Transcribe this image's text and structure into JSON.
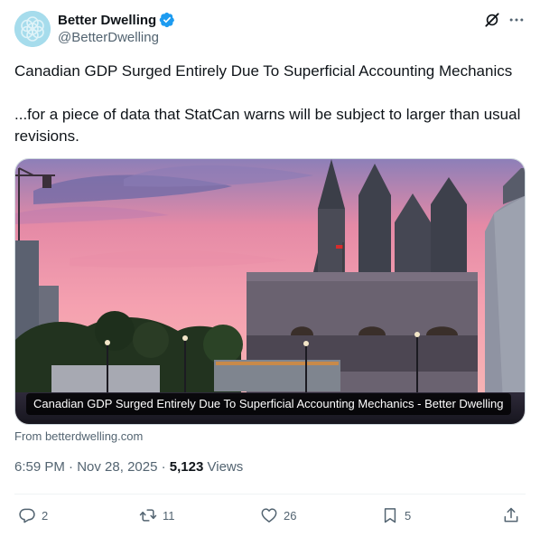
{
  "author": {
    "display_name": "Better Dwelling",
    "handle": "@BetterDwelling",
    "verified": true
  },
  "tweet": {
    "text_line1": "Canadian GDP Surged Entirely Due To Superficial Accounting Mechanics",
    "text_line2": "...for a piece of data that StatCan warns will be subject to larger than usual revisions."
  },
  "card": {
    "caption": "Canadian GDP Surged Entirely Due To Superficial Accounting Mechanics - Better Dwelling",
    "source": "From betterdwelling.com"
  },
  "meta": {
    "time": "6:59 PM",
    "sep1": " · ",
    "date": "Nov 28, 2025",
    "sep2": " · ",
    "views_count": "5,123",
    "views_label": " Views"
  },
  "actions": {
    "replies": "2",
    "reposts": "11",
    "likes": "26",
    "bookmarks": "5"
  },
  "colors": {
    "text_primary": "#0f1419",
    "text_secondary": "#536471",
    "verified_blue": "#1d9bf0",
    "divider": "#eff3f4"
  },
  "icons": [
    "avatar-logo",
    "verified-icon",
    "grok-icon",
    "more-icon",
    "reply-icon",
    "repost-icon",
    "like-icon",
    "bookmark-icon",
    "share-icon"
  ]
}
